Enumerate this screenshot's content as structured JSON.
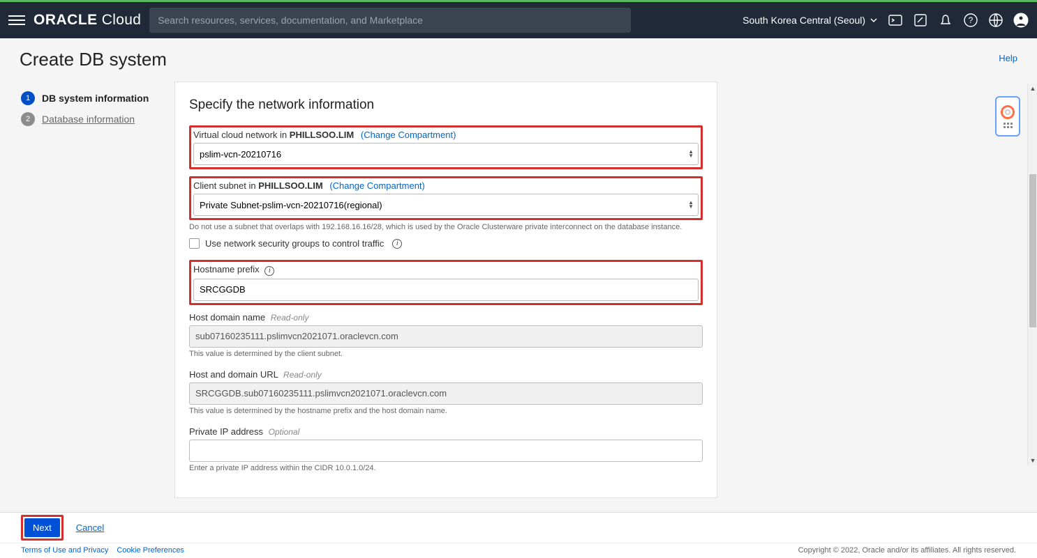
{
  "topbar": {
    "logo": "ORACLE Cloud",
    "search_placeholder": "Search resources, services, documentation, and Marketplace",
    "region": "South Korea Central (Seoul)"
  },
  "page": {
    "title": "Create DB system",
    "help": "Help"
  },
  "steps": {
    "s1": "DB system information",
    "s2": "Database information"
  },
  "form": {
    "heading": "Specify the network information",
    "vcn_label_prefix": "Virtual cloud network in ",
    "vcn_compartment": "PHILLSOO.LIM",
    "change_compartment": "(Change Compartment)",
    "vcn_value": "pslim-vcn-20210716",
    "subnet_label_prefix": "Client subnet in ",
    "subnet_compartment": "PHILLSOO.LIM",
    "subnet_value": "Private Subnet-pslim-vcn-20210716(regional)",
    "subnet_help": "Do not use a subnet that overlaps with 192.168.16.16/28, which is used by the Oracle Clusterware private interconnect on the database instance.",
    "nsg_checkbox": "Use network security groups to control traffic",
    "hostname_label": "Hostname prefix",
    "hostname_value": "SRCGGDB",
    "hostdomain_label": "Host domain name",
    "readonly": "Read-only",
    "hostdomain_value": "sub07160235111.pslimvcn2021071.oraclevcn.com",
    "hostdomain_help": "This value is determined by the client subnet.",
    "hosturl_label": "Host and domain URL",
    "hosturl_value": "SRCGGDB.sub07160235111.pslimvcn2021071.oraclevcn.com",
    "hosturl_help": "This value is determined by the hostname prefix and the host domain name.",
    "privateip_label": "Private IP address",
    "optional": "Optional",
    "privateip_value": "",
    "privateip_help": "Enter a private IP address within the CIDR 10.0.1.0/24."
  },
  "actions": {
    "next": "Next",
    "cancel": "Cancel"
  },
  "legal": {
    "terms": "Terms of Use and Privacy",
    "cookie": "Cookie Preferences",
    "copyright": "Copyright © 2022, Oracle and/or its affiliates. All rights reserved."
  }
}
